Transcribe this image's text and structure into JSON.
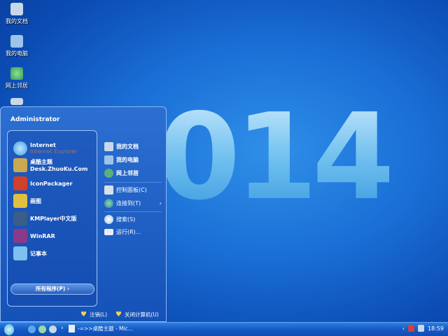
{
  "wallpaper": {
    "year": "2014"
  },
  "desktop_icons": [
    {
      "label": "我的文档",
      "icon": "documents-icon"
    },
    {
      "label": "我的电脑",
      "icon": "computer-icon"
    },
    {
      "label": "网上邻居",
      "icon": "network-icon"
    }
  ],
  "start_menu": {
    "user": "Administrator",
    "programs": [
      {
        "label": "Internet",
        "sub": "Internet Explorer",
        "icon": "ie-icon",
        "color": "#3f9be6"
      },
      {
        "label": "桌酷主题",
        "sub2": "Desk.ZhuoKu.Com",
        "icon": "theme-icon",
        "color": "#c8a850"
      },
      {
        "label": "IconPackager",
        "icon": "iconpackager-icon",
        "color": "#d0402a"
      },
      {
        "label": "画图",
        "icon": "paint-icon",
        "color": "#e0c040"
      },
      {
        "label": "KMPlayer中文版",
        "icon": "kmplayer-icon",
        "color": "#3a5e88"
      },
      {
        "label": "WinRAR",
        "icon": "winrar-icon",
        "color": "#8a3a8a"
      },
      {
        "label": "记事本",
        "icon": "notepad-icon",
        "color": "#7cc0ee"
      }
    ],
    "all_programs": "所有程序(P)  ›",
    "places": [
      {
        "label": "我的文档",
        "bold": true
      },
      {
        "label": "我的电脑",
        "bold": true
      },
      {
        "label": "网上邻居",
        "bold": true
      },
      {
        "label": "控制面板(C)"
      },
      {
        "label": "连接到(T)",
        "arrow": "›"
      },
      {
        "label": "搜索(S)"
      },
      {
        "label": "运行(R)..."
      }
    ],
    "logoff": "注销(L)",
    "shutdown": "关闭计算机(U)"
  },
  "taskbar": {
    "task": "-=>>桌酷主题 - Mic...",
    "clock": "18:59",
    "chevron": "›",
    "tray_expand": "‹"
  }
}
